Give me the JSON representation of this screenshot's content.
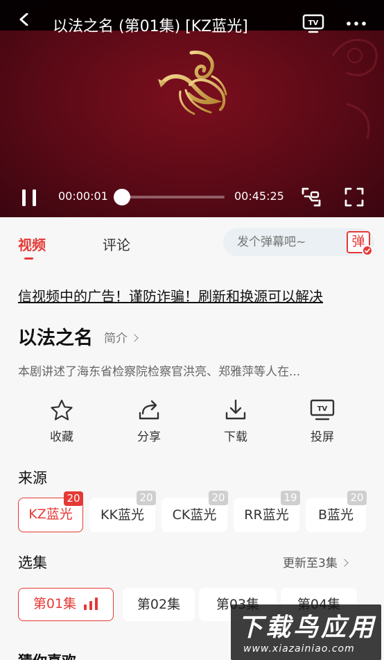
{
  "player": {
    "title": "以法之名 (第01集) [KZ蓝光]",
    "current_time": "00:00:01",
    "total_time": "00:45:25",
    "progress_fraction": 0.0
  },
  "tabs": {
    "video": "视频",
    "comment": "评论"
  },
  "danmaku": {
    "placeholder": "发个弹幕吧~",
    "toggle_label": "弹"
  },
  "notice": "信视频中的广告！谨防诈骗！刷新和换源可以解决",
  "show": {
    "title": "以法之名",
    "intro_label": "简介",
    "description": "本剧讲述了海东省检察院检察官洪亮、郑雅萍等人在..."
  },
  "actions": {
    "favorite": "收藏",
    "share": "分享",
    "download": "下载",
    "cast": "投屏"
  },
  "sources": {
    "title": "来源",
    "items": [
      {
        "label": "KZ蓝光",
        "count": "20",
        "active": true
      },
      {
        "label": "KK蓝光",
        "count": "20",
        "active": false
      },
      {
        "label": "CK蓝光",
        "count": "20",
        "active": false
      },
      {
        "label": "RR蓝光",
        "count": "19",
        "active": false
      },
      {
        "label": "B蓝光",
        "count": "20",
        "active": false
      }
    ]
  },
  "episodes": {
    "title": "选集",
    "update_label": "更新至3集",
    "items": [
      {
        "label": "第01集",
        "active": true
      },
      {
        "label": "第02集",
        "active": false
      },
      {
        "label": "第03集",
        "active": false
      },
      {
        "label": "第04集",
        "active": false
      }
    ]
  },
  "recommend": {
    "title": "猜你喜欢"
  },
  "watermark": {
    "main": "下载鸟应用",
    "sub": "www.xiazainiao.com"
  },
  "colors": {
    "accent": "#e53935",
    "player_bg": "#5a0a16",
    "emblem": "#d4a84b"
  }
}
